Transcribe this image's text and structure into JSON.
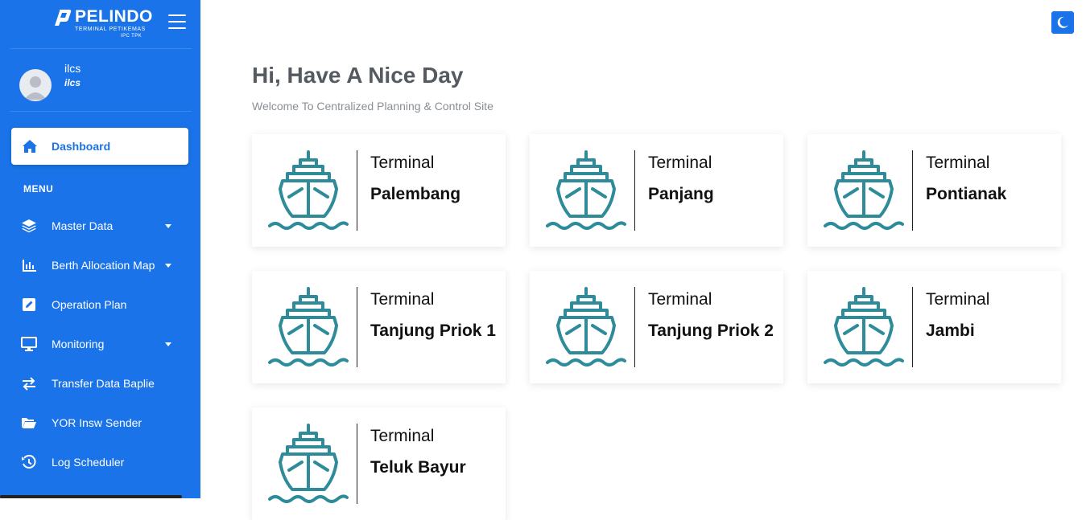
{
  "brand": {
    "name": "PELINDO",
    "subtitle": "TERMINAL PETIKEMAS",
    "subtitle2": "IPC TPK"
  },
  "user": {
    "name": "ilcs",
    "role": "ilcs"
  },
  "sidebar": {
    "active": {
      "label": "Dashboard",
      "icon": "home-icon"
    },
    "menu_heading": "MENU",
    "items": [
      {
        "label": "Master Data",
        "icon": "layers-icon",
        "has_caret": true
      },
      {
        "label": "Berth Allocation Map",
        "icon": "bar-chart-icon",
        "has_caret": true
      },
      {
        "label": "Operation Plan",
        "icon": "edit-icon",
        "has_caret": false
      },
      {
        "label": "Monitoring",
        "icon": "monitor-icon",
        "has_caret": true
      },
      {
        "label": "Transfer Data Baplie",
        "icon": "exchange-icon",
        "has_caret": false
      },
      {
        "label": "YOR Insw Sender",
        "icon": "folder-open-icon",
        "has_caret": false
      },
      {
        "label": "Log Scheduler",
        "icon": "history-icon",
        "has_caret": false
      }
    ]
  },
  "header": {
    "theme_toggle_icon": "moon-icon"
  },
  "main": {
    "greeting": "Hi, Have A Nice Day",
    "welcome": "Welcome To Centralized Planning & Control Site",
    "terminals": [
      {
        "prefix": "Terminal",
        "name": "Palembang"
      },
      {
        "prefix": "Terminal",
        "name": "Panjang"
      },
      {
        "prefix": "Terminal",
        "name": "Pontianak"
      },
      {
        "prefix": "Terminal",
        "name": "Tanjung Priok 1"
      },
      {
        "prefix": "Terminal",
        "name": "Tanjung Priok 2"
      },
      {
        "prefix": "Terminal",
        "name": "Jambi"
      },
      {
        "prefix": "Terminal",
        "name": "Teluk Bayur"
      }
    ]
  },
  "colors": {
    "sidebar": "#1a73e8",
    "ship_icon": "#2e8c9a",
    "text_dark": "#555a60"
  }
}
